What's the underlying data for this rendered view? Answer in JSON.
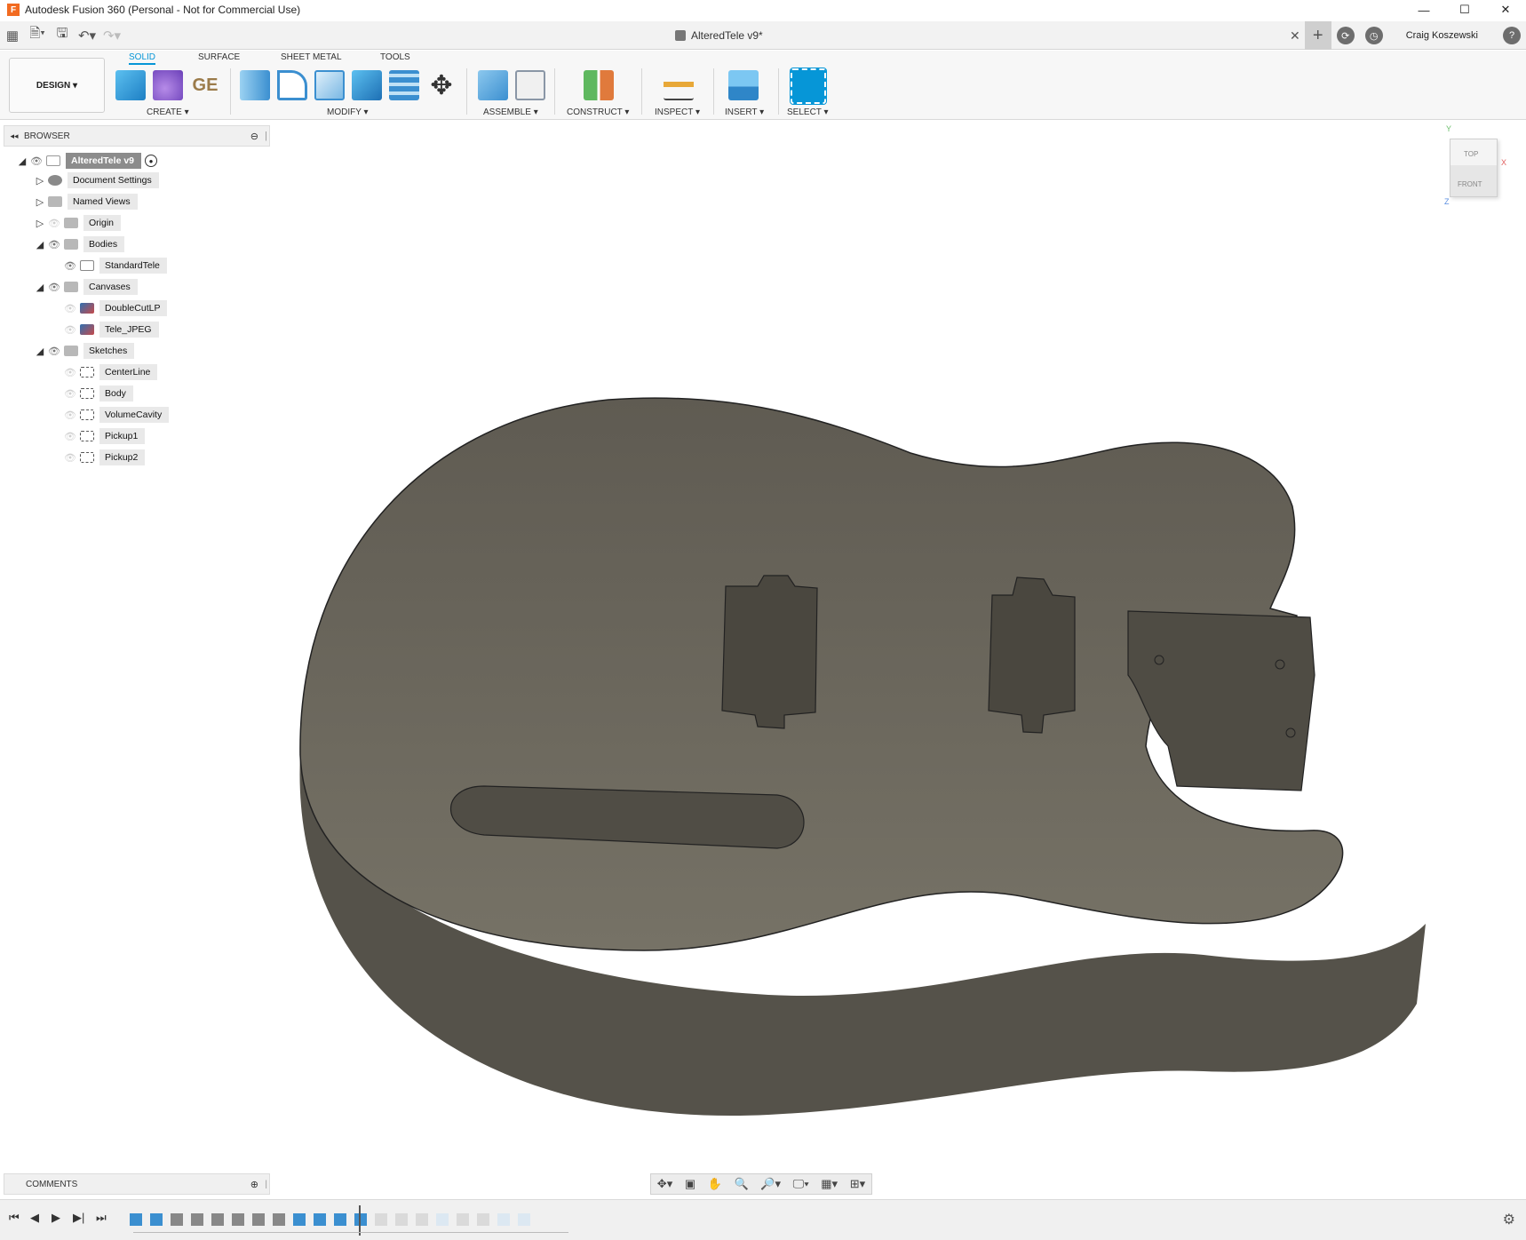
{
  "window": {
    "title": "Autodesk Fusion 360 (Personal - Not for Commercial Use)",
    "logo_letter": "F",
    "minimize": "—",
    "maximize": "☐",
    "close": "✕"
  },
  "quick_access": {
    "document_title": "AlteredTele v9*",
    "close_tab": "✕",
    "user_name": "Craig Koszewski",
    "help": "?"
  },
  "ribbon": {
    "workspace": "DESIGN ▾",
    "tabs": [
      "SOLID",
      "SURFACE",
      "SHEET METAL",
      "TOOLS"
    ],
    "active_tab": "SOLID",
    "groups": [
      "CREATE ▾",
      "MODIFY ▾",
      "ASSEMBLE ▾",
      "CONSTRUCT ▾",
      "INSPECT ▾",
      "INSERT ▾",
      "SELECT ▾"
    ]
  },
  "browser": {
    "title": "BROWSER",
    "root": "AlteredTele v9",
    "items": [
      {
        "label": "Document Settings",
        "type": "settings",
        "expander": "closed"
      },
      {
        "label": "Named Views",
        "type": "folder",
        "expander": "closed"
      },
      {
        "label": "Origin",
        "type": "folder",
        "expander": "closed"
      },
      {
        "label": "Bodies",
        "type": "folder",
        "expander": "open"
      },
      {
        "label": "StandardTele",
        "type": "body",
        "expander": "none"
      },
      {
        "label": "Canvases",
        "type": "folder",
        "expander": "open"
      },
      {
        "label": "DoubleCutLP",
        "type": "canvas",
        "expander": "none"
      },
      {
        "label": "Tele_JPEG",
        "type": "canvas",
        "expander": "none"
      },
      {
        "label": "Sketches",
        "type": "folder",
        "expander": "open"
      },
      {
        "label": "CenterLine",
        "type": "sketch",
        "expander": "none"
      },
      {
        "label": "Body",
        "type": "sketch",
        "expander": "none"
      },
      {
        "label": "VolumeCavity",
        "type": "sketch",
        "expander": "none"
      },
      {
        "label": "Pickup1",
        "type": "sketch",
        "expander": "none"
      },
      {
        "label": "Pickup2",
        "type": "sketch",
        "expander": "none"
      }
    ]
  },
  "viewcube": {
    "top": "TOP",
    "front": "FRONT",
    "x": "X",
    "y": "Y",
    "z": "Z"
  },
  "comments": {
    "title": "COMMENTS"
  },
  "colors": {
    "accent": "#0696d7",
    "body": "#6b665c",
    "body_side": "#55524a"
  }
}
